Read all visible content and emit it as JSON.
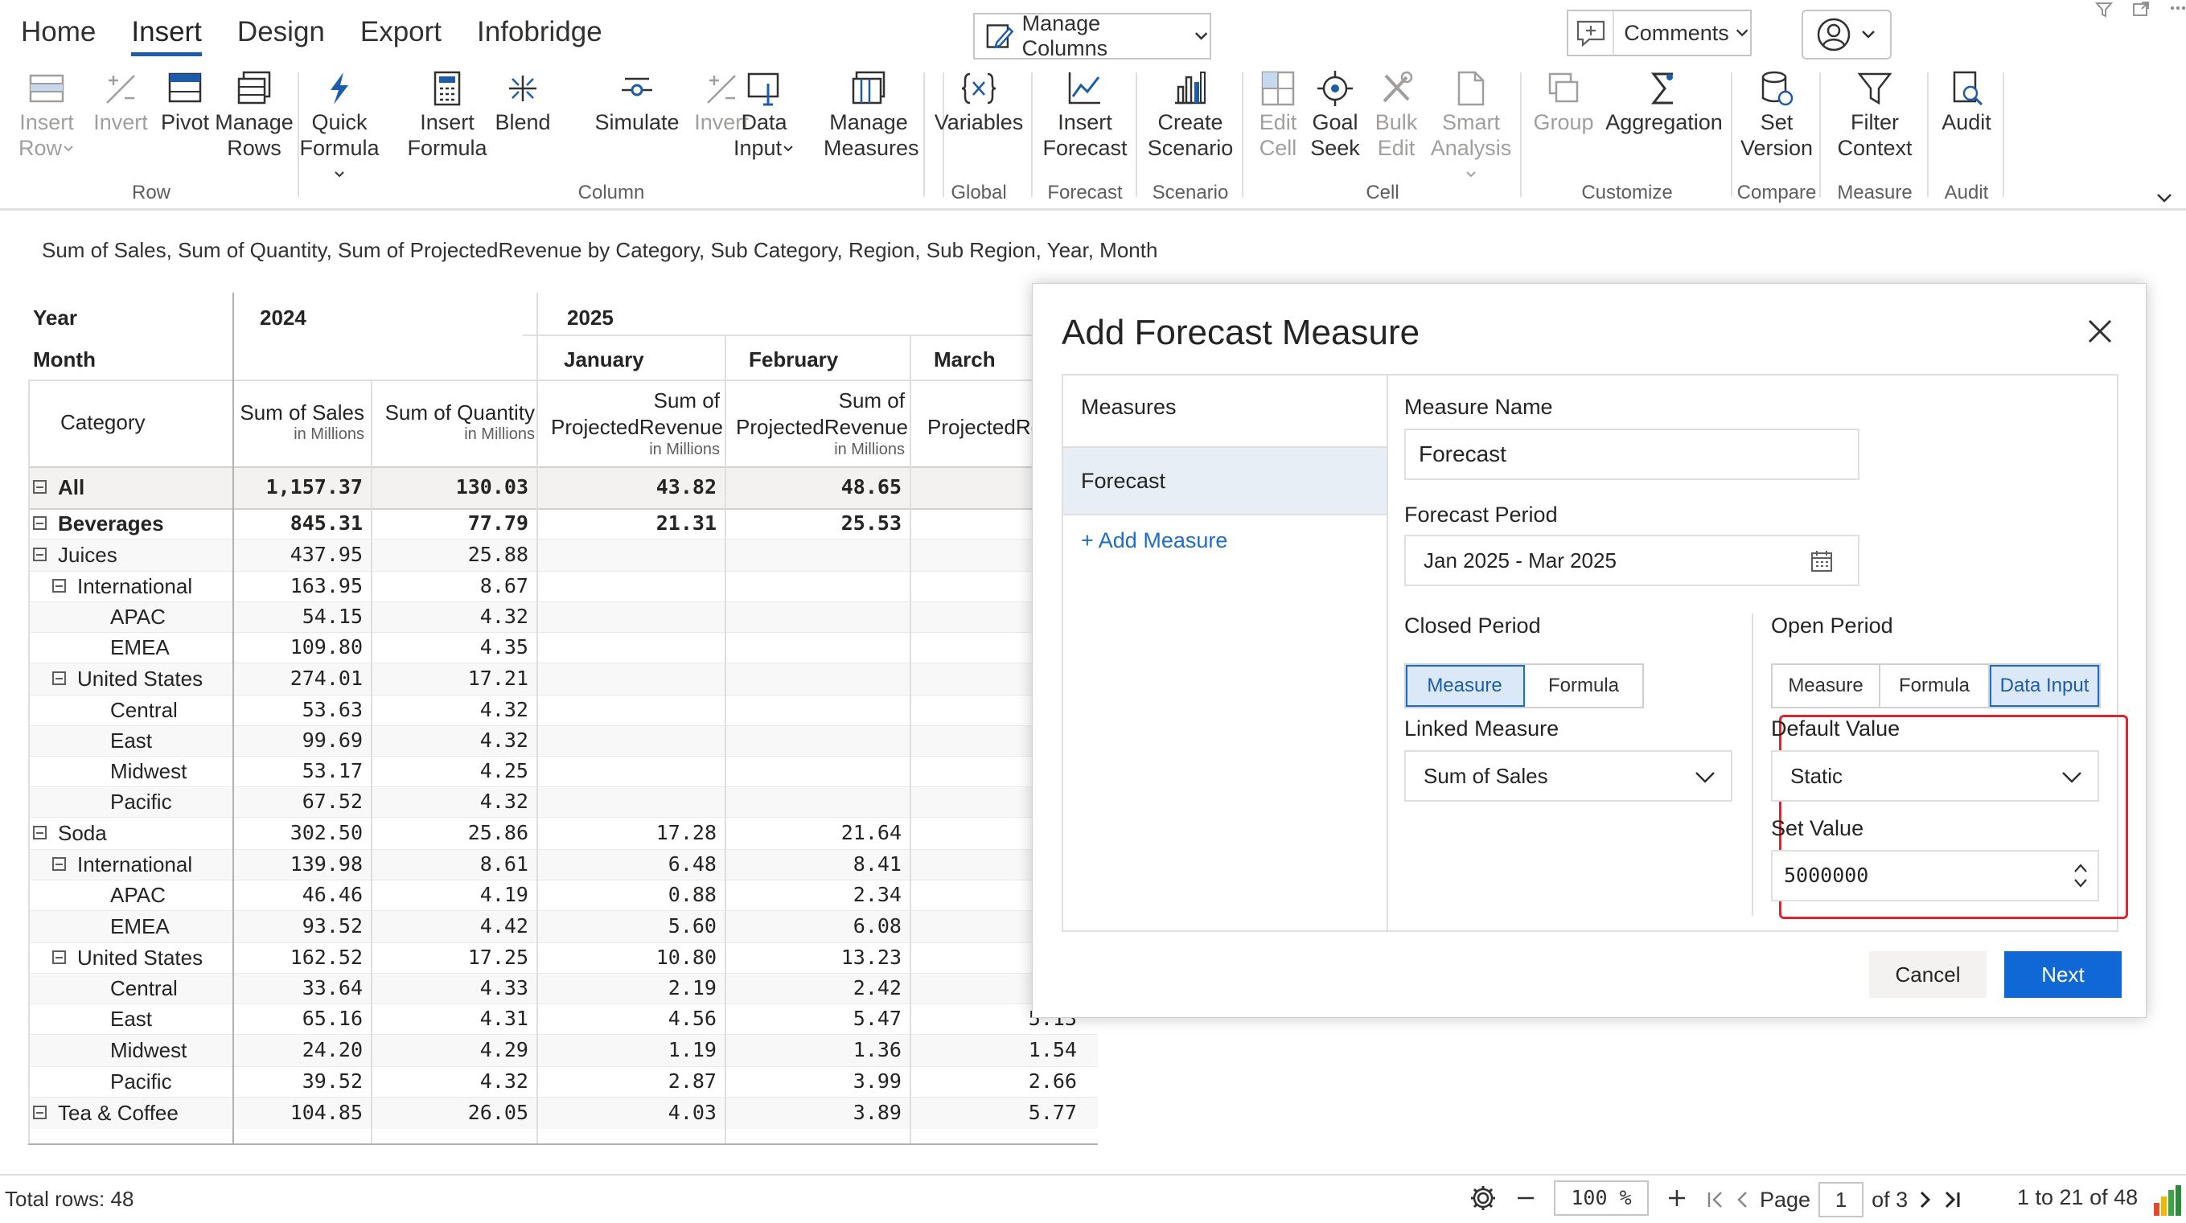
{
  "menu": {
    "tabs": [
      "Home",
      "Insert",
      "Design",
      "Export",
      "Infobridge"
    ],
    "active_tab": "Insert"
  },
  "toolbar": {
    "manage_columns": "Manage Columns",
    "comments": "Comments"
  },
  "ribbon": {
    "groups": {
      "row": "Row",
      "column": "Column",
      "global": "Global",
      "forecast": "Forecast",
      "scenario": "Scenario",
      "cell": "Cell",
      "customize": "Customize",
      "compare": "Compare",
      "measure": "Measure",
      "audit": "Audit"
    },
    "buttons": {
      "insert_row_1": "Insert",
      "insert_row_2": "Row",
      "invert_row": "Invert",
      "pivot": "Pivot",
      "manage_rows_1": "Manage",
      "manage_rows_2": "Rows",
      "quick_formula_1": "Quick",
      "quick_formula_2": "Formula",
      "insert_formula_1": "Insert",
      "insert_formula_2": "Formula",
      "blend": "Blend",
      "simulate": "Simulate",
      "invert_col": "Invert",
      "data_input_1": "Data",
      "data_input_2": "Input",
      "manage_measures_1": "Manage",
      "manage_measures_2": "Measures",
      "variables": "Variables",
      "insert_forecast_1": "Insert",
      "insert_forecast_2": "Forecast",
      "create_scenario_1": "Create",
      "create_scenario_2": "Scenario",
      "edit_cell_1": "Edit",
      "edit_cell_2": "Cell",
      "goal_seek_1": "Goal",
      "goal_seek_2": "Seek",
      "bulk_edit_1": "Bulk",
      "bulk_edit_2": "Edit",
      "smart_analysis_1": "Smart",
      "smart_analysis_2": "Analysis",
      "group": "Group",
      "aggregation": "Aggregation",
      "set_version_1": "Set",
      "set_version_2": "Version",
      "filter_context_1": "Filter",
      "filter_context_2": "Context",
      "audit": "Audit"
    }
  },
  "report": {
    "subtitle": "Sum of Sales, Sum of Quantity, Sum of ProjectedRevenue by Category, Sub Category, Region, Sub Region, Year, Month",
    "header": {
      "year_label": "Year",
      "month_label": "Month",
      "category_label": "Category",
      "year_2024": "2024",
      "year_2025": "2025",
      "months": [
        "January",
        "February",
        "March"
      ],
      "sum_sales": "Sum of Sales",
      "sum_quantity": "Sum of Quantity",
      "sum_of": "Sum of",
      "projected_revenue": "ProjectedRevenue",
      "projected_re_cut": "ProjectedRe",
      "unit": "in Millions",
      "unit_cut": "in",
      "s_cut": "S"
    },
    "rows": [
      {
        "label": "All",
        "level": 0,
        "bold": true,
        "expander": true,
        "sales": "1,157.37",
        "qty": "130.03",
        "jan": "43.82",
        "feb": "48.65",
        "mar": ""
      },
      {
        "label": "Beverages",
        "level": 0,
        "bold": true,
        "expander": true,
        "sales": "845.31",
        "qty": "77.79",
        "jan": "21.31",
        "feb": "25.53",
        "mar": ""
      },
      {
        "label": "Juices",
        "level": 1,
        "bold": false,
        "expander": true,
        "sales": "437.95",
        "qty": "25.88",
        "jan": "",
        "feb": "",
        "mar": ""
      },
      {
        "label": "International",
        "level": 2,
        "bold": false,
        "expander": true,
        "sales": "163.95",
        "qty": "8.67",
        "jan": "",
        "feb": "",
        "mar": ""
      },
      {
        "label": "APAC",
        "level": 3,
        "bold": false,
        "expander": false,
        "sales": "54.15",
        "qty": "4.32",
        "jan": "",
        "feb": "",
        "mar": ""
      },
      {
        "label": "EMEA",
        "level": 3,
        "bold": false,
        "expander": false,
        "sales": "109.80",
        "qty": "4.35",
        "jan": "",
        "feb": "",
        "mar": ""
      },
      {
        "label": "United States",
        "level": 2,
        "bold": false,
        "expander": true,
        "sales": "274.01",
        "qty": "17.21",
        "jan": "",
        "feb": "",
        "mar": ""
      },
      {
        "label": "Central",
        "level": 3,
        "bold": false,
        "expander": false,
        "sales": "53.63",
        "qty": "4.32",
        "jan": "",
        "feb": "",
        "mar": ""
      },
      {
        "label": "East",
        "level": 3,
        "bold": false,
        "expander": false,
        "sales": "99.69",
        "qty": "4.32",
        "jan": "",
        "feb": "",
        "mar": ""
      },
      {
        "label": "Midwest",
        "level": 3,
        "bold": false,
        "expander": false,
        "sales": "53.17",
        "qty": "4.25",
        "jan": "",
        "feb": "",
        "mar": ""
      },
      {
        "label": "Pacific",
        "level": 3,
        "bold": false,
        "expander": false,
        "sales": "67.52",
        "qty": "4.32",
        "jan": "",
        "feb": "",
        "mar": ""
      },
      {
        "label": "Soda",
        "level": 1,
        "bold": false,
        "expander": true,
        "sales": "302.50",
        "qty": "25.86",
        "jan": "17.28",
        "feb": "21.64",
        "mar": ""
      },
      {
        "label": "International",
        "level": 2,
        "bold": false,
        "expander": true,
        "sales": "139.98",
        "qty": "8.61",
        "jan": "6.48",
        "feb": "8.41",
        "mar": ""
      },
      {
        "label": "APAC",
        "level": 3,
        "bold": false,
        "expander": false,
        "sales": "46.46",
        "qty": "4.19",
        "jan": "0.88",
        "feb": "2.34",
        "mar": ""
      },
      {
        "label": "EMEA",
        "level": 3,
        "bold": false,
        "expander": false,
        "sales": "93.52",
        "qty": "4.42",
        "jan": "5.60",
        "feb": "6.08",
        "mar": ""
      },
      {
        "label": "United States",
        "level": 2,
        "bold": false,
        "expander": true,
        "sales": "162.52",
        "qty": "17.25",
        "jan": "10.80",
        "feb": "13.23",
        "mar": ""
      },
      {
        "label": "Central",
        "level": 3,
        "bold": false,
        "expander": false,
        "sales": "33.64",
        "qty": "4.33",
        "jan": "2.19",
        "feb": "2.42",
        "mar": ""
      },
      {
        "label": "East",
        "level": 3,
        "bold": false,
        "expander": false,
        "sales": "65.16",
        "qty": "4.31",
        "jan": "4.56",
        "feb": "5.47",
        "mar": "5.13"
      },
      {
        "label": "Midwest",
        "level": 3,
        "bold": false,
        "expander": false,
        "sales": "24.20",
        "qty": "4.29",
        "jan": "1.19",
        "feb": "1.36",
        "mar": "1.54"
      },
      {
        "label": "Pacific",
        "level": 3,
        "bold": false,
        "expander": false,
        "sales": "39.52",
        "qty": "4.32",
        "jan": "2.87",
        "feb": "3.99",
        "mar": "2.66"
      },
      {
        "label": "Tea & Coffee",
        "level": 1,
        "bold": false,
        "expander": true,
        "sales": "104.85",
        "qty": "26.05",
        "jan": "4.03",
        "feb": "3.89",
        "mar": "5.77"
      }
    ]
  },
  "dialog": {
    "title": "Add Forecast Measure",
    "measures_header": "Measures",
    "measures_item": "Forecast",
    "add_measure": "+ Add Measure",
    "measure_name_label": "Measure Name",
    "measure_name_value": "Forecast",
    "forecast_period_label": "Forecast Period",
    "forecast_period_value": "Jan 2025 - Mar 2025",
    "closed_period_label": "Closed Period",
    "closed_options": [
      "Measure",
      "Formula"
    ],
    "closed_selected": "Measure",
    "linked_measure_label": "Linked Measure",
    "linked_measure_value": "Sum of Sales",
    "open_period_label": "Open Period",
    "open_options": [
      "Measure",
      "Formula",
      "Data Input"
    ],
    "open_selected": "Data Input",
    "default_value_label": "Default Value",
    "default_value_value": "Static",
    "set_value_label": "Set Value",
    "set_value_value": "5000000",
    "cancel": "Cancel",
    "next": "Next"
  },
  "footer": {
    "total_rows": "Total rows: 48",
    "zoom": "100 %",
    "page_label": "Page",
    "page_value": "1",
    "page_of": "of 3",
    "range": "1 to 21 of 48"
  },
  "colors": {
    "accent": "#1068d6",
    "selected_bg": "#dbe8f7",
    "highlight": "#e0232e",
    "header_underline": "#1d5cab"
  }
}
